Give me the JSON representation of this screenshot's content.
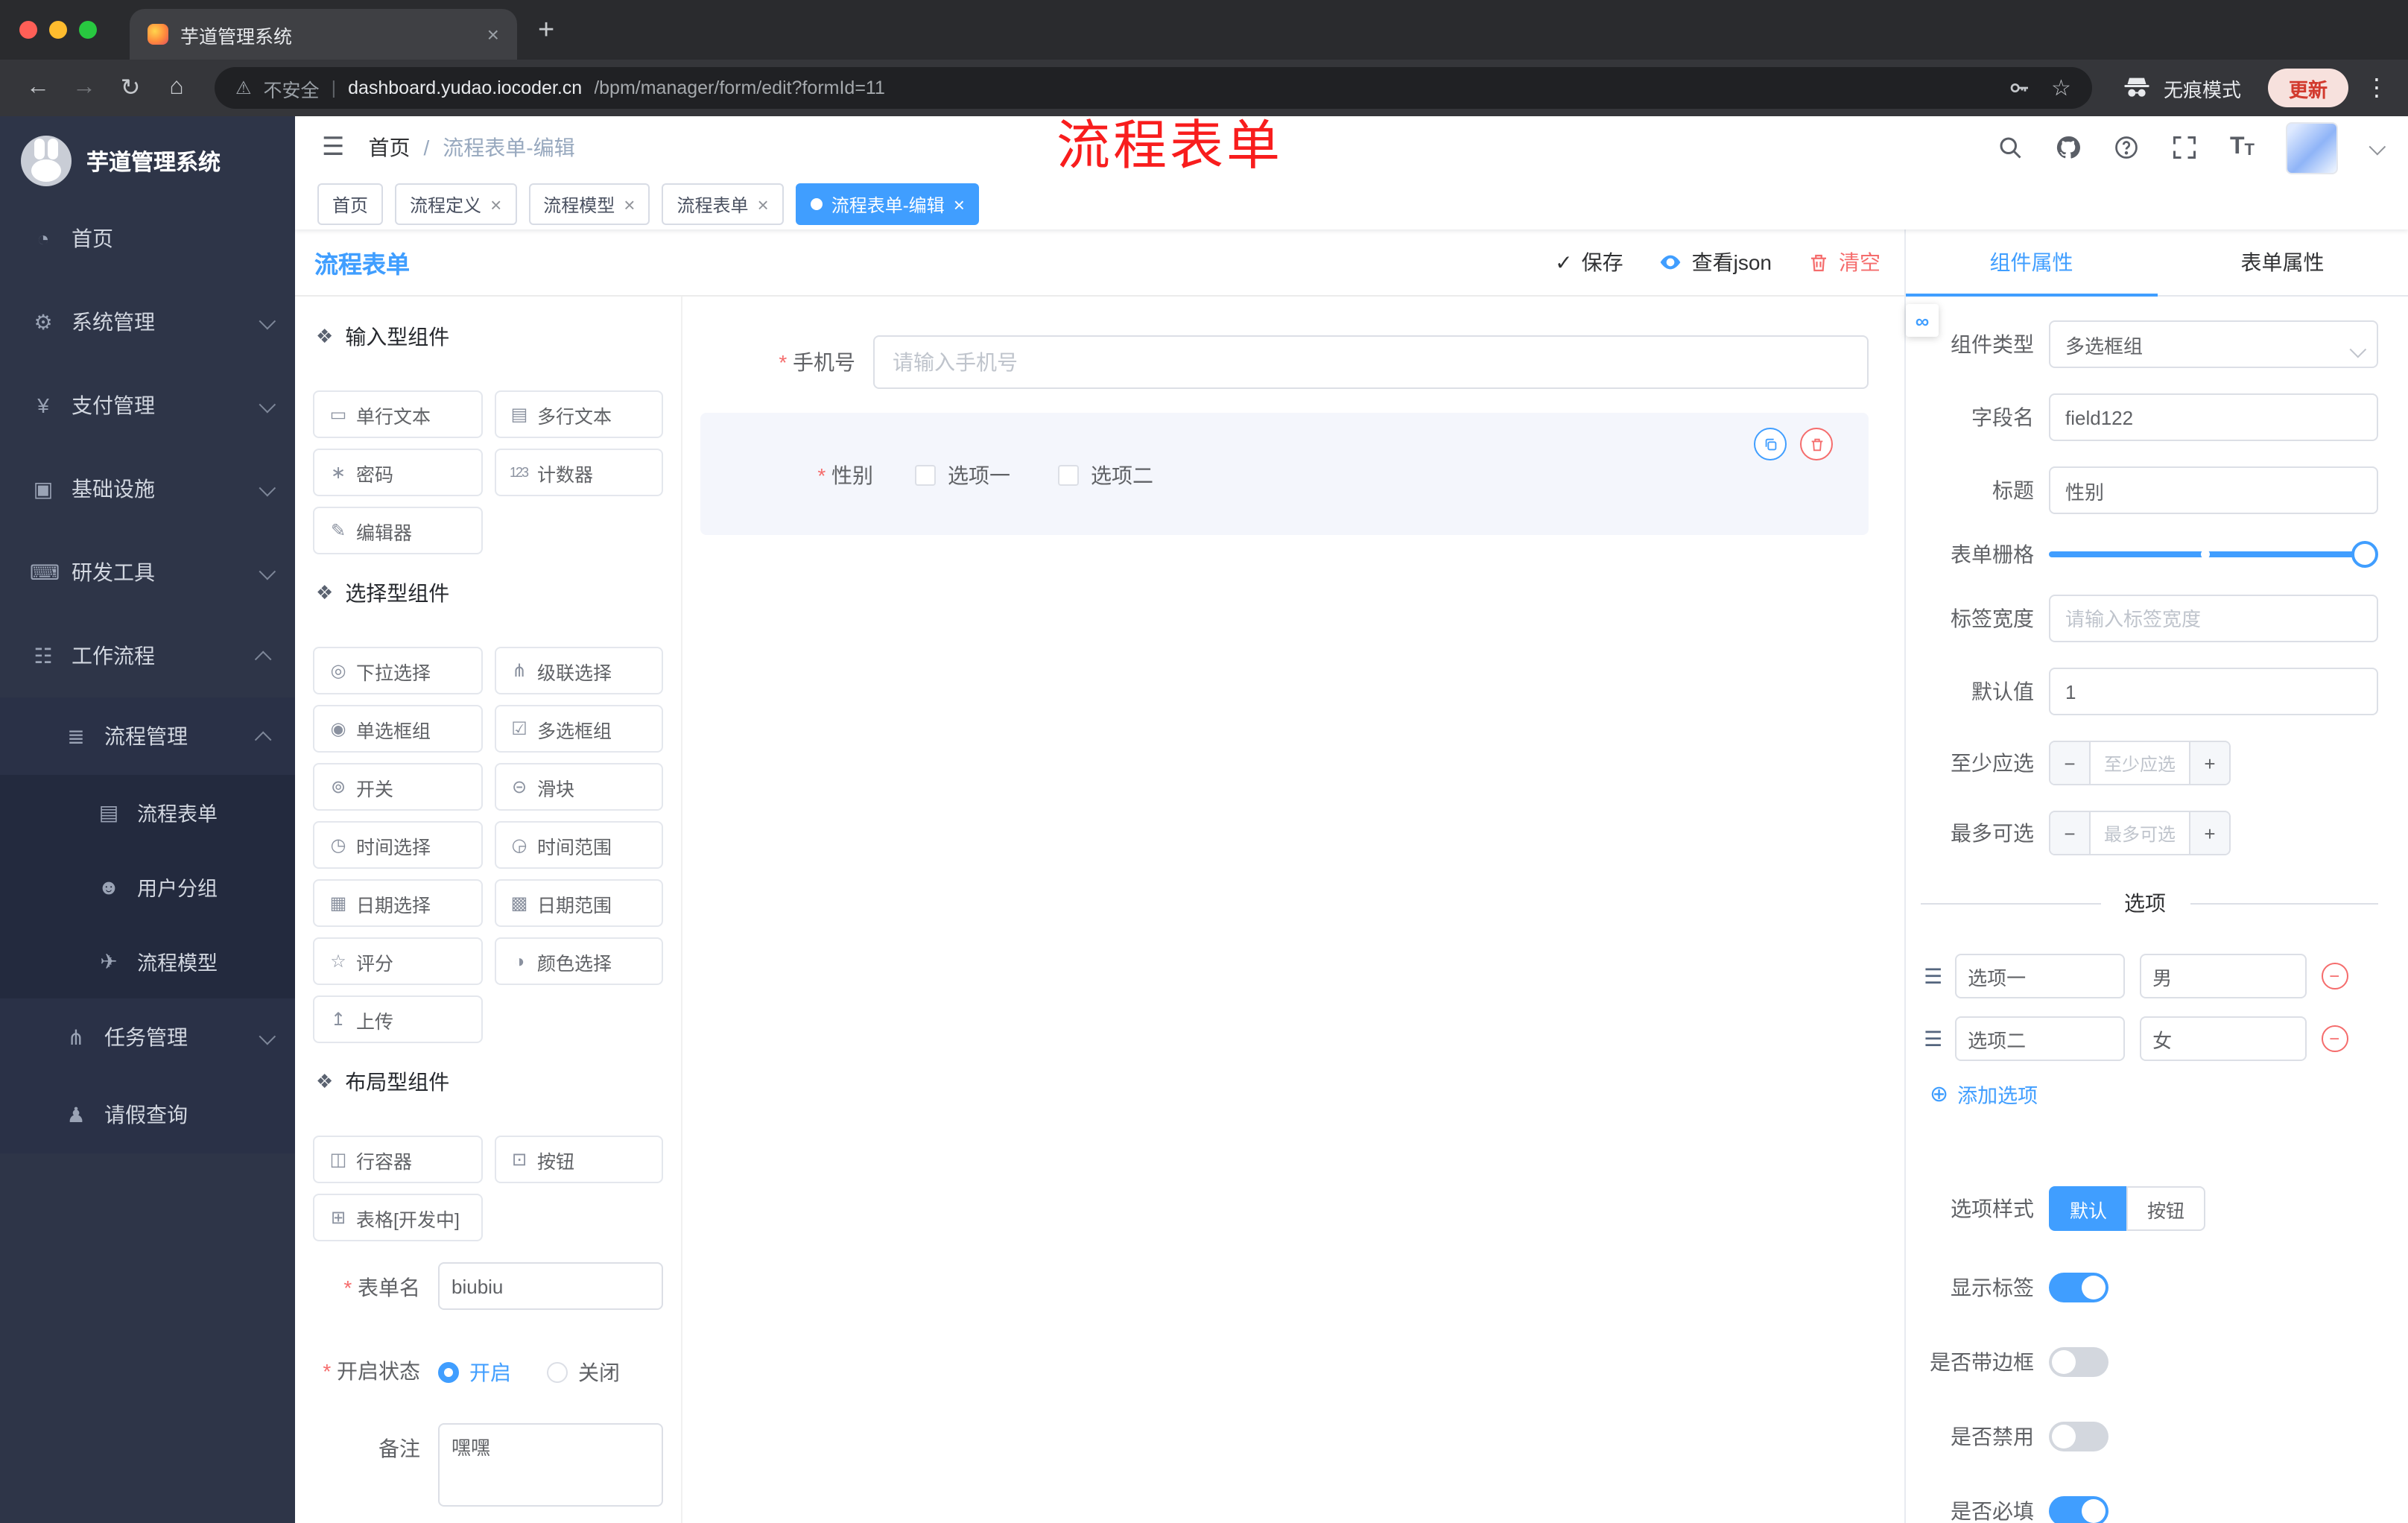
{
  "colors": {
    "accent": "#409eff",
    "danger": "#f56c6c",
    "annotation_red": "#f81d1d",
    "sidebar_bg": "#2e3548",
    "traffic_red": "#ff5f57",
    "traffic_yellow": "#febc2e",
    "traffic_green": "#28c840"
  },
  "icons": {
    "hamburger": "☰",
    "back": "←",
    "forward": "→",
    "reload": "↻",
    "home_nav": "⌂",
    "warning": "⚠",
    "star": "☆",
    "plus": "+",
    "close": "×",
    "dots": "⋮",
    "check": "✓",
    "link": "∞",
    "drag": "☰",
    "add_circle": "⊕",
    "minus": "−",
    "font_t_large": "T",
    "font_t_small": "T",
    "menu_home": "◔",
    "menu_system": "⚙",
    "menu_pay": "¥",
    "menu_infra": "▣",
    "menu_dev": "⌨",
    "menu_workflow": "☷",
    "menu_process_mgmt": "≣",
    "menu_process_form": "▤",
    "menu_user_group": "☻",
    "menu_process_model": "✈",
    "menu_task_mgmt": "⋔",
    "menu_leave": "♟",
    "section": "❖"
  },
  "browser": {
    "tab_title": "芋道管理系统",
    "url_warning": "不安全",
    "url_sep": "|",
    "url_domain": "dashboard.yudao.iocoder.cn",
    "url_path": "/bpm/manager/form/edit?formId=11",
    "incognito_label": "无痕模式",
    "update_label": "更新"
  },
  "sidebar": {
    "logo_title": "芋道管理系统",
    "items": [
      {
        "label": "首页"
      },
      {
        "label": "系统管理"
      },
      {
        "label": "支付管理"
      },
      {
        "label": "基础设施"
      },
      {
        "label": "研发工具"
      },
      {
        "label": "工作流程"
      },
      {
        "label": "流程管理"
      },
      {
        "label": "流程表单"
      },
      {
        "label": "用户分组"
      },
      {
        "label": "流程模型"
      },
      {
        "label": "任务管理"
      },
      {
        "label": "请假查询"
      }
    ]
  },
  "header": {
    "breadcrumb": [
      "首页",
      "流程表单-编辑"
    ],
    "breadcrumb_sep": "/",
    "annotation": "流程表单"
  },
  "tags": [
    {
      "label": "首页"
    },
    {
      "label": "流程定义"
    },
    {
      "label": "流程模型"
    },
    {
      "label": "流程表单"
    },
    {
      "label": "流程表单-编辑"
    }
  ],
  "designer": {
    "title": "流程表单",
    "save_label": "保存",
    "view_json_label": "查看json",
    "clear_label": "清空"
  },
  "palette": {
    "sections": [
      {
        "title": "输入型组件",
        "items": [
          {
            "label": "单行文本",
            "glyph": "▭"
          },
          {
            "label": "多行文本",
            "glyph": "▤"
          },
          {
            "label": "密码",
            "glyph": "∗"
          },
          {
            "label": "计数器",
            "glyph": "123"
          },
          {
            "label": "编辑器",
            "glyph": "✎"
          }
        ]
      },
      {
        "title": "选择型组件",
        "items": [
          {
            "label": "下拉选择",
            "glyph": "◎"
          },
          {
            "label": "级联选择",
            "glyph": "⋔"
          },
          {
            "label": "单选框组",
            "glyph": "◉"
          },
          {
            "label": "多选框组",
            "glyph": "☑"
          },
          {
            "label": "开关",
            "glyph": "⊚"
          },
          {
            "label": "滑块",
            "glyph": "⊝"
          },
          {
            "label": "时间选择",
            "glyph": "◷"
          },
          {
            "label": "时间范围",
            "glyph": "◶"
          },
          {
            "label": "日期选择",
            "glyph": "▦"
          },
          {
            "label": "日期范围",
            "glyph": "▩"
          },
          {
            "label": "评分",
            "glyph": "☆"
          },
          {
            "label": "颜色选择",
            "glyph": "◑"
          },
          {
            "label": "上传",
            "glyph": "↥"
          }
        ]
      },
      {
        "title": "布局型组件",
        "items": [
          {
            "label": "行容器",
            "glyph": "◫"
          },
          {
            "label": "按钮",
            "glyph": "⊡"
          },
          {
            "label": "表格[开发中]",
            "glyph": "⊞"
          }
        ]
      }
    ],
    "form": {
      "name_label": "表单名",
      "name_value": "biubiu",
      "status_label": "开启状态",
      "status_on": "开启",
      "status_off": "关闭",
      "remark_label": "备注",
      "remark_value": "嘿嘿"
    }
  },
  "canvas": {
    "phone": {
      "label": "手机号",
      "placeholder": "请输入手机号"
    },
    "gender": {
      "label": "性别",
      "options": [
        "选项一",
        "选项二"
      ]
    }
  },
  "inspector": {
    "tabs": [
      "组件属性",
      "表单属性"
    ],
    "rows": {
      "component_type": {
        "label": "组件类型",
        "value": "多选框组"
      },
      "field_name": {
        "label": "字段名",
        "value": "field122"
      },
      "title": {
        "label": "标题",
        "value": "性别"
      },
      "grid": {
        "label": "表单栅格"
      },
      "label_width": {
        "label": "标签宽度",
        "placeholder": "请输入标签宽度"
      },
      "default_value": {
        "label": "默认值",
        "value": "1"
      },
      "min_select": {
        "label": "至少应选",
        "placeholder": "至少应选"
      },
      "max_select": {
        "label": "最多可选",
        "placeholder": "最多可选"
      }
    },
    "options": {
      "divider_label": "选项",
      "items": [
        {
          "label": "选项一",
          "value": "男"
        },
        {
          "label": "选项二",
          "value": "女"
        }
      ],
      "add_label": "添加选项"
    },
    "style_row": {
      "label": "选项样式",
      "options": [
        "默认",
        "按钮"
      ],
      "selected": "默认"
    },
    "switches": [
      {
        "label": "显示标签",
        "on": true
      },
      {
        "label": "是否带边框",
        "on": false
      },
      {
        "label": "是否禁用",
        "on": false
      },
      {
        "label": "是否必填",
        "on": true
      }
    ]
  }
}
